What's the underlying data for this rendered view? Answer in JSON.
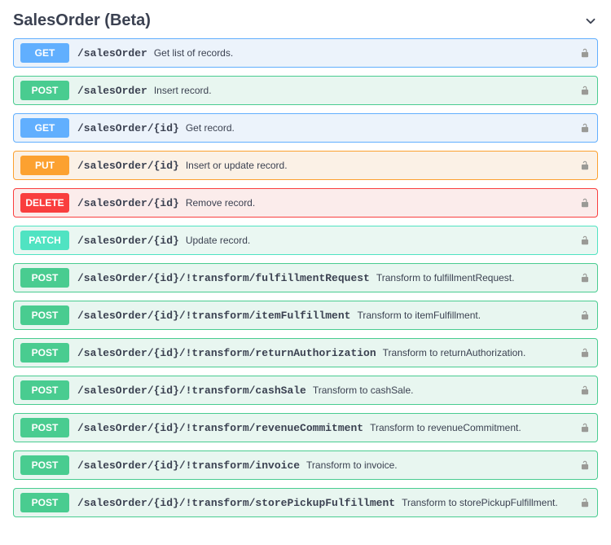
{
  "section": {
    "title": "SalesOrder (Beta)"
  },
  "methods": {
    "get": "GET",
    "post": "POST",
    "put": "PUT",
    "delete": "DELETE",
    "patch": "PATCH"
  },
  "ops": [
    {
      "method": "get",
      "path": "/salesOrder",
      "summary": "Get list of records."
    },
    {
      "method": "post",
      "path": "/salesOrder",
      "summary": "Insert record."
    },
    {
      "method": "get",
      "path": "/salesOrder/{id}",
      "summary": "Get record."
    },
    {
      "method": "put",
      "path": "/salesOrder/{id}",
      "summary": "Insert or update record."
    },
    {
      "method": "delete",
      "path": "/salesOrder/{id}",
      "summary": "Remove record."
    },
    {
      "method": "patch",
      "path": "/salesOrder/{id}",
      "summary": "Update record."
    },
    {
      "method": "post",
      "path": "/salesOrder/{id}/!transform/fulfillmentRequest",
      "summary": "Transform to fulfillmentRequest."
    },
    {
      "method": "post",
      "path": "/salesOrder/{id}/!transform/itemFulfillment",
      "summary": "Transform to itemFulfillment."
    },
    {
      "method": "post",
      "path": "/salesOrder/{id}/!transform/returnAuthorization",
      "summary": "Transform to returnAuthorization."
    },
    {
      "method": "post",
      "path": "/salesOrder/{id}/!transform/cashSale",
      "summary": "Transform to cashSale."
    },
    {
      "method": "post",
      "path": "/salesOrder/{id}/!transform/revenueCommitment",
      "summary": "Transform to revenueCommitment."
    },
    {
      "method": "post",
      "path": "/salesOrder/{id}/!transform/invoice",
      "summary": "Transform to invoice."
    },
    {
      "method": "post",
      "path": "/salesOrder/{id}/!transform/storePickupFulfillment",
      "summary": "Transform to storePickupFulfillment."
    }
  ]
}
